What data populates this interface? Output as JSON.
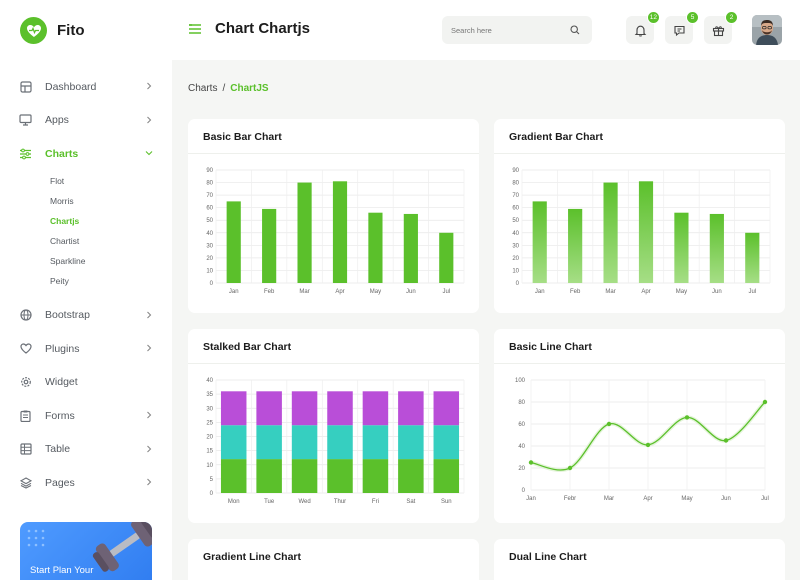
{
  "brand": {
    "name": "Fito",
    "color": "#5bc02b"
  },
  "header": {
    "title": "Chart Chartjs",
    "search_placeholder": "Search here",
    "notifications": [
      {
        "icon": "bell-icon",
        "count": "12"
      },
      {
        "icon": "chat-icon",
        "count": "5"
      },
      {
        "icon": "gift-icon",
        "count": "2"
      }
    ]
  },
  "breadcrumb": {
    "parent": "Charts",
    "separator": "/",
    "current": "ChartJS"
  },
  "sidebar": {
    "items": [
      {
        "label": "Dashboard",
        "icon": "dashboard-icon",
        "has_chevron": true
      },
      {
        "label": "Apps",
        "icon": "monitor-icon",
        "has_chevron": true
      },
      {
        "label": "Charts",
        "icon": "sliders-icon",
        "has_chevron": true,
        "active": true
      },
      {
        "label": "Bootstrap",
        "icon": "globe-icon",
        "has_chevron": true
      },
      {
        "label": "Plugins",
        "icon": "heart-icon",
        "has_chevron": true
      },
      {
        "label": "Widget",
        "icon": "gear-icon",
        "has_chevron": false
      },
      {
        "label": "Forms",
        "icon": "clipboard-icon",
        "has_chevron": true
      },
      {
        "label": "Table",
        "icon": "table-icon",
        "has_chevron": true
      },
      {
        "label": "Pages",
        "icon": "layers-icon",
        "has_chevron": true
      }
    ],
    "charts_submenu": [
      "Flot",
      "Morris",
      "Chartjs",
      "Chartist",
      "Sparkline",
      "Peity"
    ],
    "charts_submenu_active": "Chartjs",
    "promo_text": "Start Plan Your"
  },
  "cards": {
    "basic_bar": "Basic Bar Chart",
    "gradient_bar": "Gradient Bar Chart",
    "stacked_bar": "Stalked Bar Chart",
    "basic_line": "Basic Line Chart",
    "gradient_line": "Gradient Line Chart",
    "dual_line": "Dual Line Chart"
  },
  "chart_data": [
    {
      "type": "bar",
      "title": "Basic Bar Chart",
      "categories": [
        "Jan",
        "Feb",
        "Mar",
        "Apr",
        "May",
        "Jun",
        "Jul"
      ],
      "values": [
        65,
        59,
        80,
        81,
        56,
        55,
        40
      ],
      "ylim": [
        0,
        90
      ],
      "yticks": [
        0,
        10,
        20,
        30,
        40,
        50,
        60,
        70,
        80,
        90
      ],
      "color": "#5bc02b",
      "grid": true
    },
    {
      "type": "bar",
      "title": "Gradient Bar Chart",
      "categories": [
        "Jan",
        "Feb",
        "Mar",
        "Apr",
        "May",
        "Jun",
        "Jul"
      ],
      "values": [
        65,
        59,
        80,
        81,
        56,
        55,
        40
      ],
      "ylim": [
        0,
        90
      ],
      "yticks": [
        0,
        10,
        20,
        30,
        40,
        50,
        60,
        70,
        80,
        90
      ],
      "color": "#5bc02b",
      "color_light": "#a6de86",
      "grid": true
    },
    {
      "type": "bar",
      "stacked": true,
      "title": "Stalked Bar Chart",
      "categories": [
        "Mon",
        "Tue",
        "Wed",
        "Thur",
        "Fri",
        "Sat",
        "Sun"
      ],
      "series": [
        {
          "values": [
            12,
            12,
            12,
            12,
            12,
            12,
            12
          ],
          "color": "#5bc02b"
        },
        {
          "values": [
            12,
            12,
            12,
            12,
            12,
            12,
            12
          ],
          "color": "#36cfc0"
        },
        {
          "values": [
            12,
            12,
            12,
            12,
            12,
            12,
            12
          ],
          "color": "#b94ed8"
        }
      ],
      "ylim": [
        0,
        40
      ],
      "yticks": [
        0,
        5,
        10,
        15,
        20,
        25,
        30,
        35,
        40
      ],
      "grid": true
    },
    {
      "type": "line",
      "title": "Basic Line Chart",
      "categories": [
        "Jan",
        "Febr",
        "Mar",
        "Apr",
        "May",
        "Jun",
        "Jul"
      ],
      "values": [
        25,
        20,
        60,
        41,
        66,
        45,
        80
      ],
      "ylim": [
        0,
        100
      ],
      "yticks": [
        0,
        20,
        40,
        60,
        80,
        100
      ],
      "color": "#5bc02b",
      "grid": true
    }
  ]
}
